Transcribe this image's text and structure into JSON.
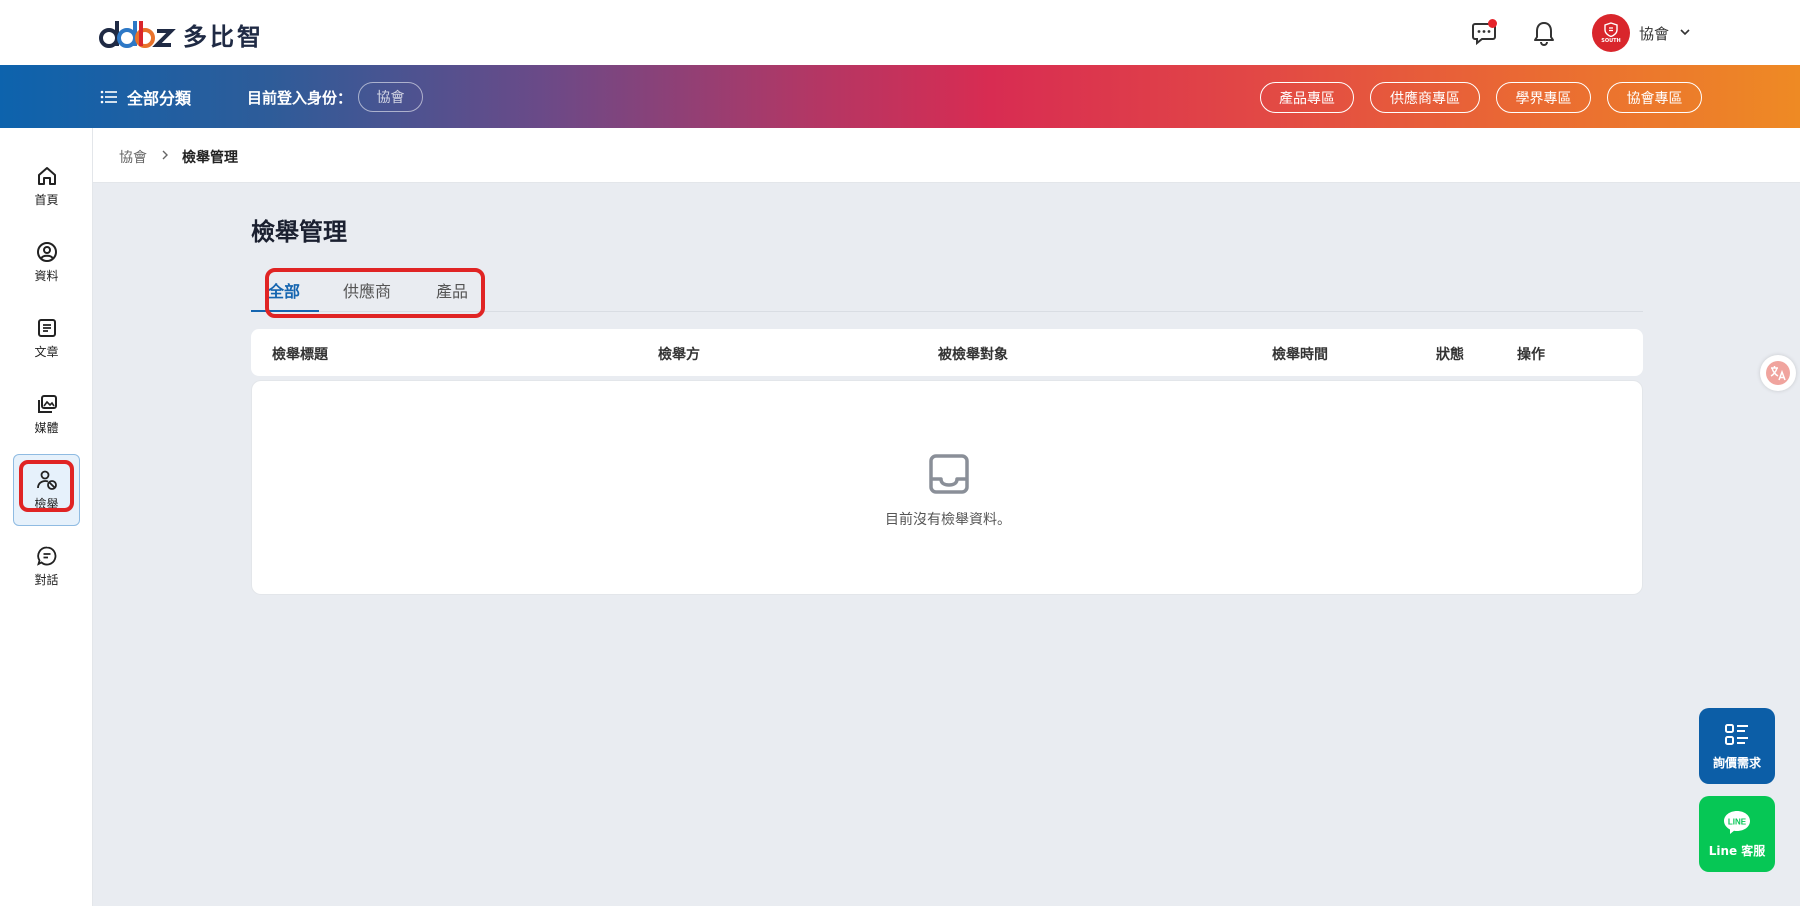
{
  "header": {
    "brand_text": "多比智",
    "user_name": "協會",
    "avatar_label": "SOUTH"
  },
  "navbar": {
    "category_label": "全部分類",
    "login_as_label": "目前登入身份：",
    "role": "協會",
    "zones": [
      "產品專區",
      "供應商專區",
      "學界專區",
      "協會專區"
    ]
  },
  "sidebar": {
    "items": [
      {
        "label": "首頁",
        "icon": "home-icon"
      },
      {
        "label": "資料",
        "icon": "user-circle-icon"
      },
      {
        "label": "文章",
        "icon": "document-icon"
      },
      {
        "label": "媒體",
        "icon": "media-icon"
      },
      {
        "label": "檢舉",
        "icon": "user-block-icon",
        "active": true
      },
      {
        "label": "對話",
        "icon": "chat-icon"
      }
    ]
  },
  "breadcrumb": {
    "root": "協會",
    "current": "檢舉管理"
  },
  "main": {
    "title": "檢舉管理",
    "tabs": [
      {
        "label": "全部",
        "active": true
      },
      {
        "label": "供應商"
      },
      {
        "label": "產品"
      }
    ],
    "columns": [
      "檢舉標題",
      "檢舉方",
      "被檢舉對象",
      "檢舉時間",
      "狀態",
      "操作"
    ],
    "empty_text": "目前沒有檢舉資料。"
  },
  "floating": {
    "quote_label": "詢價需求",
    "line_label": "Line 客服"
  },
  "colors": {
    "primary": "#1565b0",
    "highlight": "#e02424",
    "line_green": "#06c755"
  }
}
